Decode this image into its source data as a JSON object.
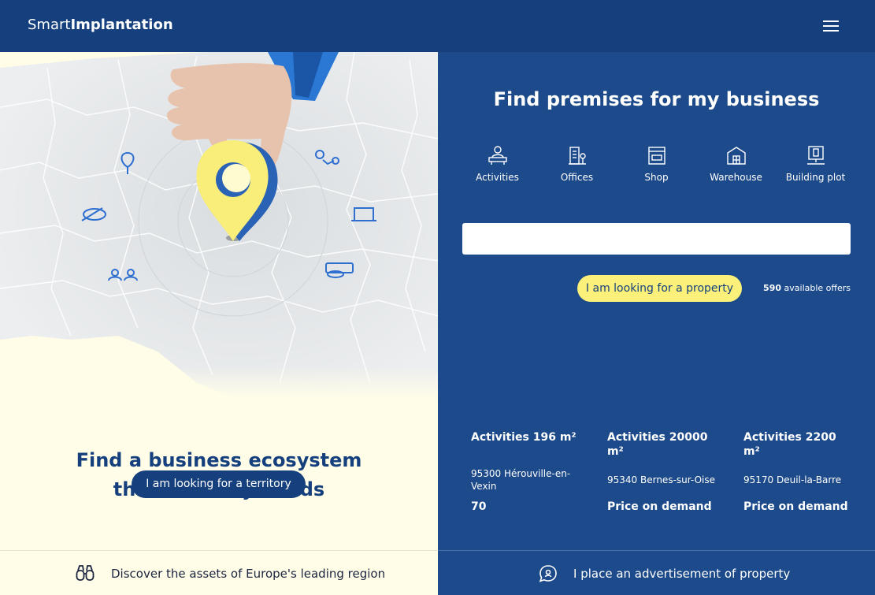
{
  "header": {
    "brand_light": "Smart",
    "brand_bold": "Implantation",
    "menu_icon": "hamburger-icon"
  },
  "left": {
    "title_line1": "Find a business ecosystem",
    "title_line2": "that suits my needs",
    "territory_button": "I am looking for a territory",
    "footer_text": "Discover the assets of Europe's leading region"
  },
  "right": {
    "title": "Find premises for my business",
    "categories": [
      {
        "label": "Activities",
        "icon": "activities-icon"
      },
      {
        "label": "Offices",
        "icon": "offices-icon"
      },
      {
        "label": "Shop",
        "icon": "shop-icon"
      },
      {
        "label": "Warehouse",
        "icon": "warehouse-icon"
      },
      {
        "label": "Building plot",
        "icon": "building-plot-icon"
      }
    ],
    "search_placeholder": "",
    "property_button": "I am looking for a property",
    "offers_count": "590",
    "offers_label": "available offers",
    "listings": [
      {
        "title": "Activities 196 m²",
        "location": "95300 Hérouville-en-Vexin",
        "price": "70"
      },
      {
        "title": "Activities 20000 m²",
        "location": "95340 Bernes-sur-Oise",
        "price": "Price on demand"
      },
      {
        "title": "Activities 2200 m²",
        "location": "95170 Deuil-la-Barre",
        "price": "Price on demand"
      }
    ],
    "footer_text": "I place an advertisement of property"
  },
  "colors": {
    "navy": "#15407d",
    "panel_blue": "#1c4a8a",
    "yellow": "#fbf07a",
    "cream": "#fffde8"
  }
}
